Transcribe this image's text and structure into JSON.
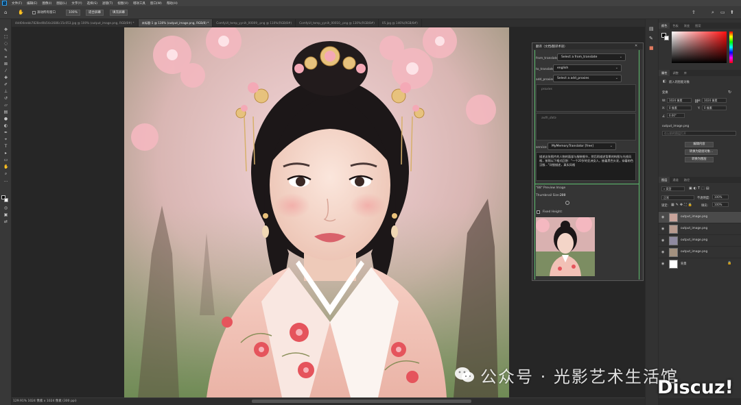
{
  "app": {
    "logo": "Ps",
    "accent": "#31a8ff"
  },
  "menu": [
    "文件(F)",
    "编辑(E)",
    "图像(I)",
    "图层(L)",
    "文字(Y)",
    "选择(S)",
    "滤镜(T)",
    "视图(V)",
    "增效工具",
    "窗口(W)",
    "帮助(H)"
  ],
  "options": {
    "scroll_all": "滚动所有窗口",
    "zoom": "100%",
    "fit_screen": "适合屏幕",
    "fill_screen": "填充屏幕"
  },
  "tabs": [
    {
      "label": "4dd04eebb7828ed0b54a1686c15c053.jpg @ 100% (output_image.png, RGB/8#) *",
      "active": false
    },
    {
      "label": "未标题-1 @ 130% (output_image.png, RGB/8) *",
      "active": true
    },
    {
      "label": "ComfyUI_temp_yynih_00009_.png @ 110%(RGB/8#)",
      "active": false
    },
    {
      "label": "ComfyUI_temp_yynih_00010_.png @ 130%(RGB/8#)",
      "active": false
    },
    {
      "label": "05.jpg @ 146%(RGB/8#)",
      "active": false
    }
  ],
  "status": "129.91% 1024 像素 x 1024 像素 (300 ppi)",
  "node": {
    "title": "翻译（文档/翻译术语）",
    "from_translate_label": "from_translate",
    "from_translate_value": "Select a from_translate",
    "to_translate_label": "to_translate",
    "to_translate_value": "english",
    "add_proxies_label": "add_proxies",
    "add_proxies_value": "Select a add_proxies",
    "proxies_placeholder": "proxies",
    "auth_data_placeholder": "auth_data",
    "service_label": "service",
    "service_value": "MyMemoryTranslator [free]",
    "text": "描述这张图片的人物的面部与服装细节，然后再描述背景的构图与光线风格，按照以下格式回答：\"一个20岁的亚洲女人，披着黑色头发，穿着粉色汉服…\"详细描述，真实风格",
    "preview_title": "\"88\" Preview Image",
    "thumb_size_label": "Thumbnail Size:",
    "thumb_size_value": "200",
    "fixed_height_label": "Fixed Height:"
  },
  "right_panel": {
    "top_tabs": [
      "颜色",
      "色板",
      "渐变",
      "图案"
    ],
    "props_tabs": [
      "属性",
      "调整",
      "库"
    ],
    "props_title": "嵌入的智能对象",
    "transform_label": "变换",
    "w_label": "W:",
    "w_value": "1024 像素",
    "h_label": "H:",
    "h_value": "1024 像素",
    "x_label": "X:",
    "x_value": "0 像素",
    "y_label": "Y:",
    "y_value": "0 像素",
    "angle": "0.00°",
    "filename": "output_image.png",
    "link_placeholder": "在以前的图层打开",
    "edit_content": "编辑内容",
    "convert_linked": "转换为链接对象...",
    "convert_layers": "转换为图层",
    "layers_tabs": [
      "图层",
      "通道",
      "路径"
    ],
    "kind_label": "类型",
    "blend_mode": "正常",
    "opacity_label": "不透明度:",
    "opacity_value": "100%",
    "lock_label": "锁定:",
    "fill_label": "填充:",
    "fill_value": "100%",
    "layers": [
      {
        "name": "output_image.png",
        "selected": true
      },
      {
        "name": "output_image.png",
        "selected": false
      },
      {
        "name": "output_image.png",
        "selected": false
      },
      {
        "name": "output_image.png",
        "selected": false
      },
      {
        "name": "背景",
        "selected": false
      }
    ]
  },
  "watermark": {
    "text": "公众号 · 光影艺术生活馆",
    "brand": "Discuz!"
  }
}
